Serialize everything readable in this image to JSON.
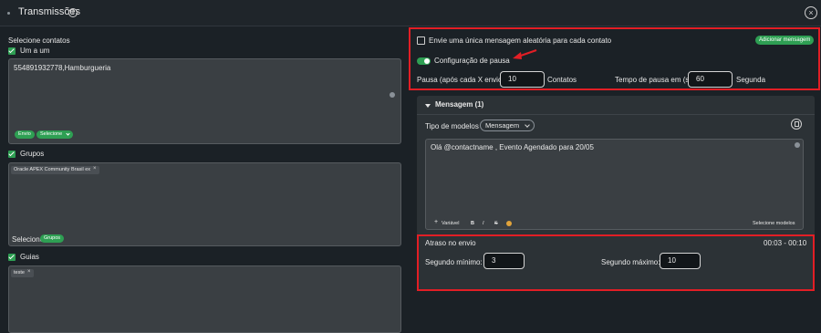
{
  "header": {
    "title": "Transmissões"
  },
  "left": {
    "section_title": "Selecione contatos",
    "one_by_one": {
      "label": "Um a um",
      "value": "554891932778,Hamburgueria",
      "pill_envio": "Envio",
      "pill_selecione": "Selecione"
    },
    "groups": {
      "label": "Grupos",
      "tag": "Oracle APEX Community Brasil ex",
      "selecione_label": "Selecione",
      "pill": "Grupos"
    },
    "guides": {
      "label": "Guias",
      "tag": "teste"
    }
  },
  "right": {
    "random_message_label": "Envie uma única mensagem aleatória para cada contato",
    "add_message_button": "Adicionar mensagem",
    "pause_config_label": "Configuração de pausa",
    "pause_after_label": "Pausa (após cada X envio):",
    "pause_after_value": "10",
    "contacts_label": "Contatos",
    "pause_time_label": "Tempo de pausa em (s):",
    "pause_time_value": "60",
    "seconds_label": "Segunda",
    "message_section": {
      "title": "Mensagem (1)",
      "model_type_label": "Tipo de modelos",
      "model_type_value": "Mensagem",
      "message_text": "Olá @contactname , Evento Agendado para 20/05",
      "toolbar": {
        "variable": "Variável",
        "bold": "B",
        "italic": "I",
        "strike": "S",
        "select_models": "Selecione modelos"
      }
    },
    "delay": {
      "title": "Atraso no envio",
      "range": "00:03 - 00:10",
      "min_label": "Segundo mínimo:",
      "min_value": "3",
      "max_label": "Segundo máximo:",
      "max_value": "10"
    }
  },
  "colors": {
    "accent": "#2e9f53",
    "highlight": "#e21e25",
    "background": "#1b2126"
  }
}
